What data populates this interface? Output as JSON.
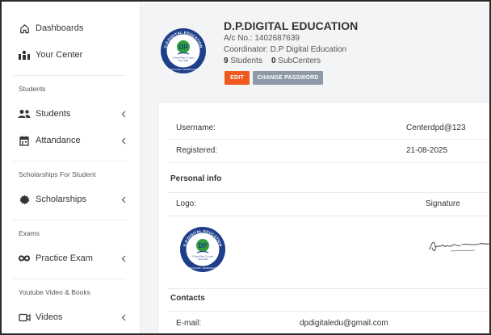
{
  "sidebar": {
    "dashboards": "Dashboards",
    "your_center": "Your Center",
    "students_section": "Students",
    "students": "Students",
    "attendance": "Attandance",
    "scholarships_section": "Scholarships For Student",
    "scholarships": "Scholarships",
    "exams_section": "Exams",
    "practice_exam": "Practice Exam",
    "youtube_section": "Youtube Video & Books",
    "videos": "Videos"
  },
  "header": {
    "title": "D.P.DIGITAL EDUCATION",
    "ac_no": "A/c No.: 1402687639",
    "coordinator": "Coordinator: D.P Digital Education",
    "students_count": "9",
    "students_label": "Students",
    "subcenters_count": "0",
    "subcenters_label": "SubCenters",
    "edit_label": "EDIT",
    "change_password_label": "CHANGE PASSWORD"
  },
  "logo": {
    "arc_text": "D.P.DIGITAL EDUCATION",
    "initials": "DP",
    "tagline": "A Great Place To Learn",
    "since": "Since 2005",
    "bottom_text": "DEOGHAR, JHARKHAND"
  },
  "details": {
    "username_label": "Username:",
    "username_value": "Centerdpd@123",
    "registered_label": "Registered:",
    "registered_value": "21-08-2025",
    "personal_info_heading": "Personal info",
    "logo_label": "Logo:",
    "signature_label": "Signature",
    "contacts_heading": "Contacts",
    "email_label": "E-mail:",
    "email_value": "dpdigitaledu@gmail.com"
  },
  "colors": {
    "edit_button": "#f05a1e",
    "password_button": "#8f9aa8",
    "logo_navy": "#1f3f8a",
    "logo_green": "#2f9e3d"
  }
}
